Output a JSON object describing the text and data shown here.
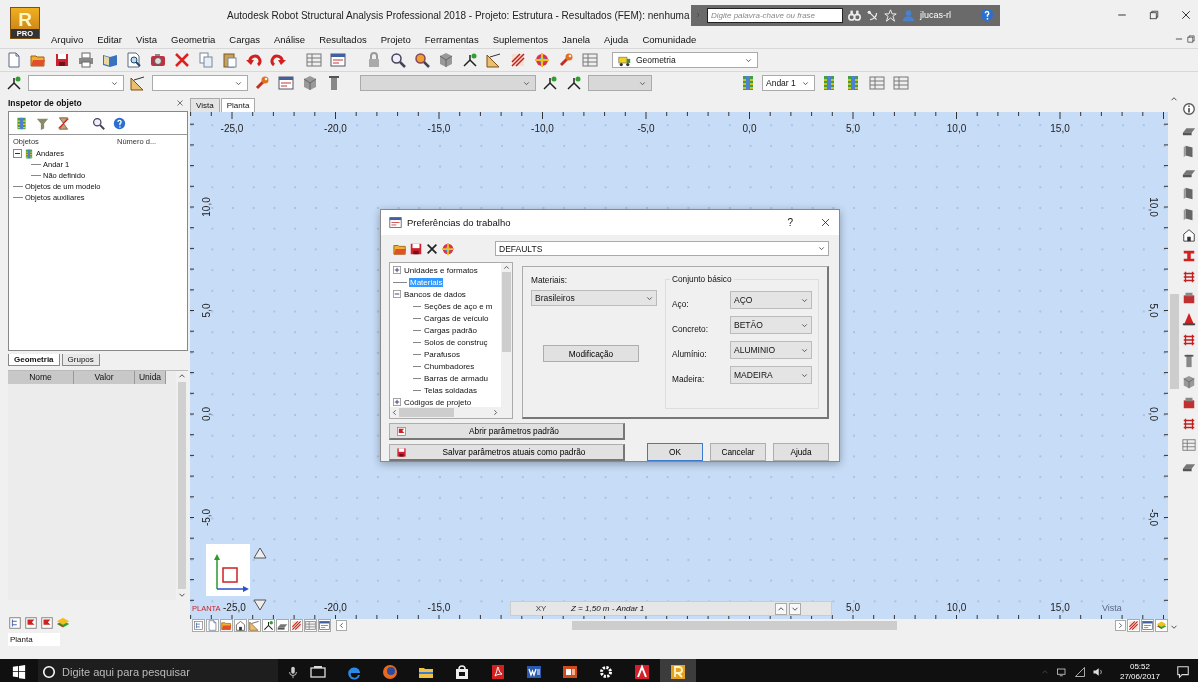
{
  "app_logo": {
    "letter": "R",
    "edition": "PRO"
  },
  "window": {
    "title": "Autodesk Robot Structural Analysis Professional 2018 - Projeto: Estrutura - Resultados (FEM): nenhuma"
  },
  "search": {
    "placeholder": "Digite palavra-chave ou frase"
  },
  "user": {
    "name": "jlucas-rl"
  },
  "menu": [
    "Arquivo",
    "Editar",
    "Vista",
    "Geometria",
    "Cargas",
    "Análise",
    "Resultados",
    "Projeto",
    "Ferramentas",
    "Suplementos",
    "Janela",
    "Ajuda",
    "Comunidade"
  ],
  "toolbar": {
    "layout": "Geometria",
    "floor": "Andar 1"
  },
  "inspector": {
    "title": "Inspetor de objeto",
    "columns": [
      "Objetos",
      "Número d..."
    ],
    "tree": [
      {
        "label": "Andares",
        "expanded": true,
        "children": [
          {
            "label": "Andar 1"
          },
          {
            "label": "Não definido"
          }
        ]
      },
      {
        "label": "Objetos de um modelo"
      },
      {
        "label": "Objetos auxiliares"
      }
    ],
    "tabs": [
      {
        "label": "Geometria",
        "selected": true
      },
      {
        "label": "Grupos",
        "selected": false
      }
    ],
    "property_columns": [
      "Nome",
      "Valor",
      "Unida"
    ]
  },
  "view_tabs": [
    {
      "label": "Vista",
      "selected": false
    },
    {
      "label": "Planta",
      "selected": true
    }
  ],
  "canvas": {
    "top_ruler": [
      "-25,0",
      "-20,0",
      "-15,0",
      "-10,0",
      "-5,0",
      "0,0",
      "5,0",
      "10,0",
      "15,0"
    ],
    "left_ruler": [
      "10,0",
      "5,0",
      "0,0",
      "-5,0"
    ],
    "right_ruler": [
      "10,0",
      "5,0",
      "0,0",
      "-5,0"
    ],
    "bottom_ruler": [
      "-25,0",
      "-20,0",
      "-15,0",
      "5,0",
      "10,0",
      "15,0"
    ],
    "view_name": "PLANTA",
    "plane": "XY",
    "level_info": "Z = 1,50 m - Andar 1",
    "corner_label": "Vista"
  },
  "dialog": {
    "title": "Preferências do trabalho",
    "help_glyph": "?",
    "preset": "DEFAULTS",
    "tree": [
      {
        "label": "Unidades e formatos",
        "expanded": false,
        "selected": false
      },
      {
        "label": "Materiais",
        "selected": true
      },
      {
        "label": "Bancos de dados",
        "expanded": true,
        "selected": false,
        "children": [
          {
            "label": "Seções de aço e m",
            "selected": false
          },
          {
            "label": "Cargas de veículo",
            "selected": false
          },
          {
            "label": "Cargas padrão",
            "selected": false
          },
          {
            "label": "Solos de construç",
            "selected": false
          },
          {
            "label": "Parafusos",
            "selected": false
          },
          {
            "label": "Chumbadores",
            "selected": false
          },
          {
            "label": "Barras de armadu",
            "selected": false
          },
          {
            "label": "Telas soldadas",
            "selected": false
          }
        ]
      },
      {
        "label": "Códigos de projeto",
        "expanded": false,
        "selected": false
      }
    ],
    "materials_label": "Materiais:",
    "materials_value": "Brasileiros",
    "modify_button": "Modificação",
    "group_title": "Conjunto básico",
    "fields": [
      {
        "label": "Aço:",
        "value": "AÇO"
      },
      {
        "label": "Concreto:",
        "value": "BETÃO"
      },
      {
        "label": "Alumínio:",
        "value": "ALUMINIO"
      },
      {
        "label": "Madeira:",
        "value": "MADEIRA"
      }
    ],
    "open_defaults": "Abrir parâmetros padrão",
    "save_defaults": "Salvar parâmetros atuais como padrão",
    "buttons": [
      "OK",
      "Cancelar",
      "Ajuda"
    ]
  },
  "status_bar": {
    "view": "Planta"
  },
  "taskbar": {
    "search_placeholder": "Digite aqui para pesquisar",
    "time": "05:52",
    "date": "27/06/2017"
  }
}
